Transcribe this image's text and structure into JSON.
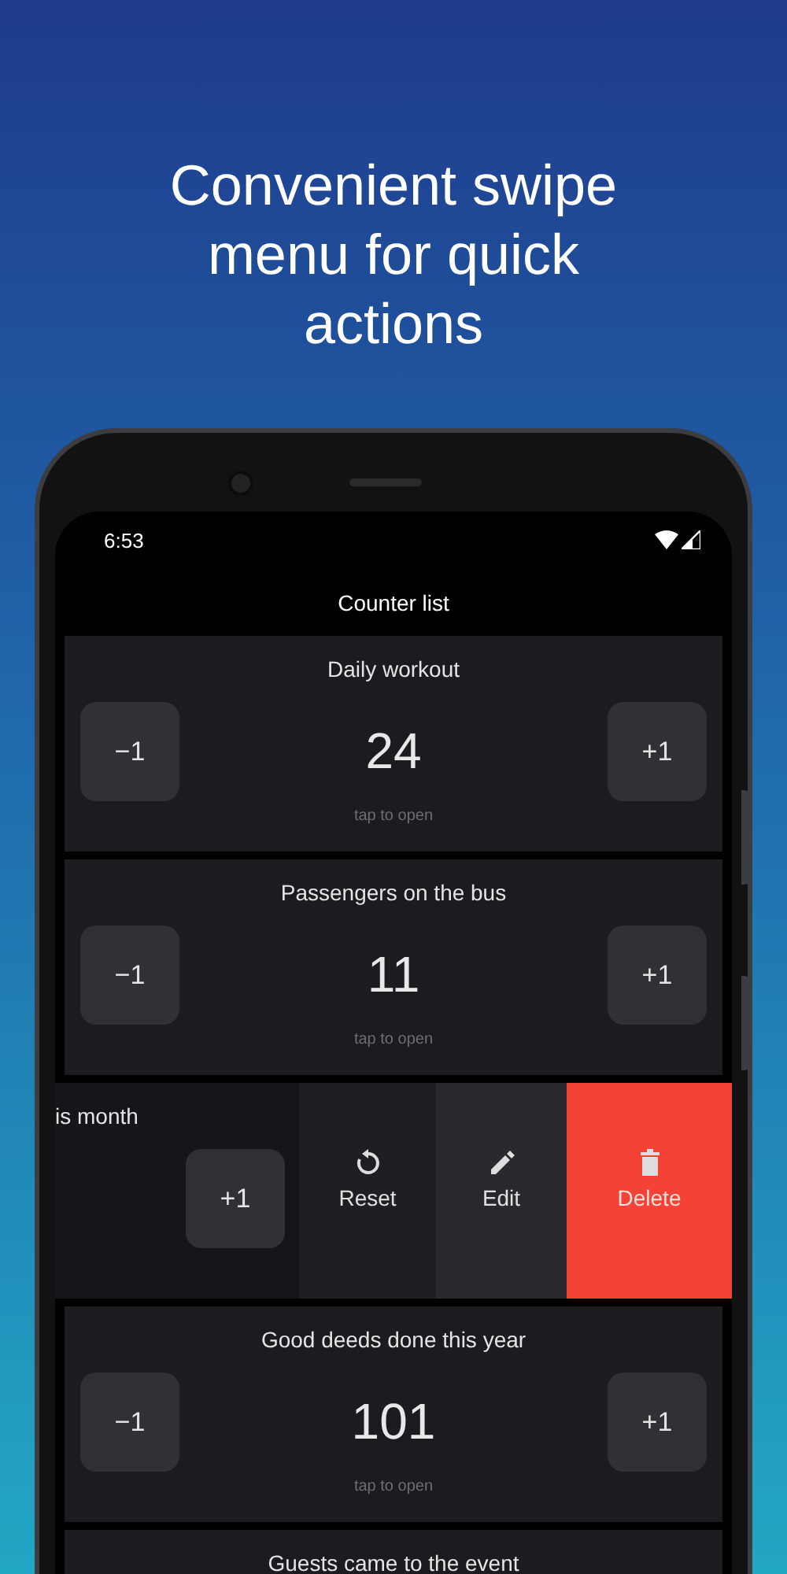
{
  "headline": "Convenient swipe menu for quick actions",
  "status_bar": {
    "time": "6:53"
  },
  "app_bar": {
    "title": "Counter list"
  },
  "counters": [
    {
      "kind": "normal",
      "title": "Daily workout",
      "decrement": "−1",
      "count": "24",
      "increment": "+1",
      "hint": "tap to open"
    },
    {
      "kind": "normal",
      "title": "Passengers on the bus",
      "decrement": "−1",
      "count": "11",
      "increment": "+1",
      "hint": "tap to open"
    },
    {
      "kind": "swiped",
      "title": "is month",
      "increment": "+1",
      "actions": [
        {
          "kind": "reset",
          "label": "Reset"
        },
        {
          "kind": "edit",
          "label": "Edit"
        },
        {
          "kind": "delete",
          "label": "Delete"
        }
      ]
    },
    {
      "kind": "normal",
      "title": "Good deeds done this year",
      "decrement": "−1",
      "count": "101",
      "increment": "+1",
      "hint": "tap to open"
    },
    {
      "kind": "partial",
      "title": "Guests came to the event"
    }
  ]
}
